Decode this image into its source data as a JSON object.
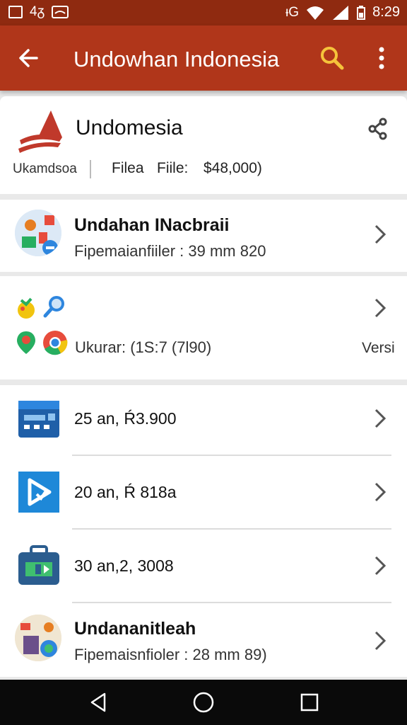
{
  "status_bar": {
    "left_text": "4ᵹ",
    "network": "ᵻG",
    "time": "8:29",
    "icons": [
      "notification-box-icon",
      "bluetooth-icon",
      "wifi-icon",
      "signal-icon",
      "battery-icon"
    ]
  },
  "app_bar": {
    "title": "Undowhan Indonesia",
    "icons": [
      "back-arrow-icon",
      "search-icon",
      "more-vertical-icon"
    ],
    "colors": {
      "bar": "#b0361a",
      "status": "#8f2a10",
      "search": "#f5c33b"
    }
  },
  "header_card": {
    "name": "Undomesia",
    "publisher": "Ukamdsoa",
    "label": "Filea",
    "file_label": "Fiile:",
    "price": "$48,000)"
  },
  "featured_item": {
    "title": "Undahan INacbraii",
    "subtitle": "Fipemaianfiiler : 39 mm 820"
  },
  "size_card": {
    "size_text": "Ukurar: (1S:7 (7l90)",
    "version_label": "Versi"
  },
  "list": [
    {
      "label": "25  an, Ŕ3.900",
      "icon": "calculator-app-icon"
    },
    {
      "label": "20  an, Ŕ 818a",
      "icon": "play-app-icon"
    },
    {
      "label": "30  an,2, 3008",
      "icon": "briefcase-app-icon"
    }
  ],
  "last_item": {
    "title": "Undananitleah",
    "subtitle": "Fipemaisnfioler : 28 mm 89)"
  },
  "nav_bar": {
    "icons": [
      "nav-back-icon",
      "nav-home-icon",
      "nav-recents-icon"
    ]
  }
}
